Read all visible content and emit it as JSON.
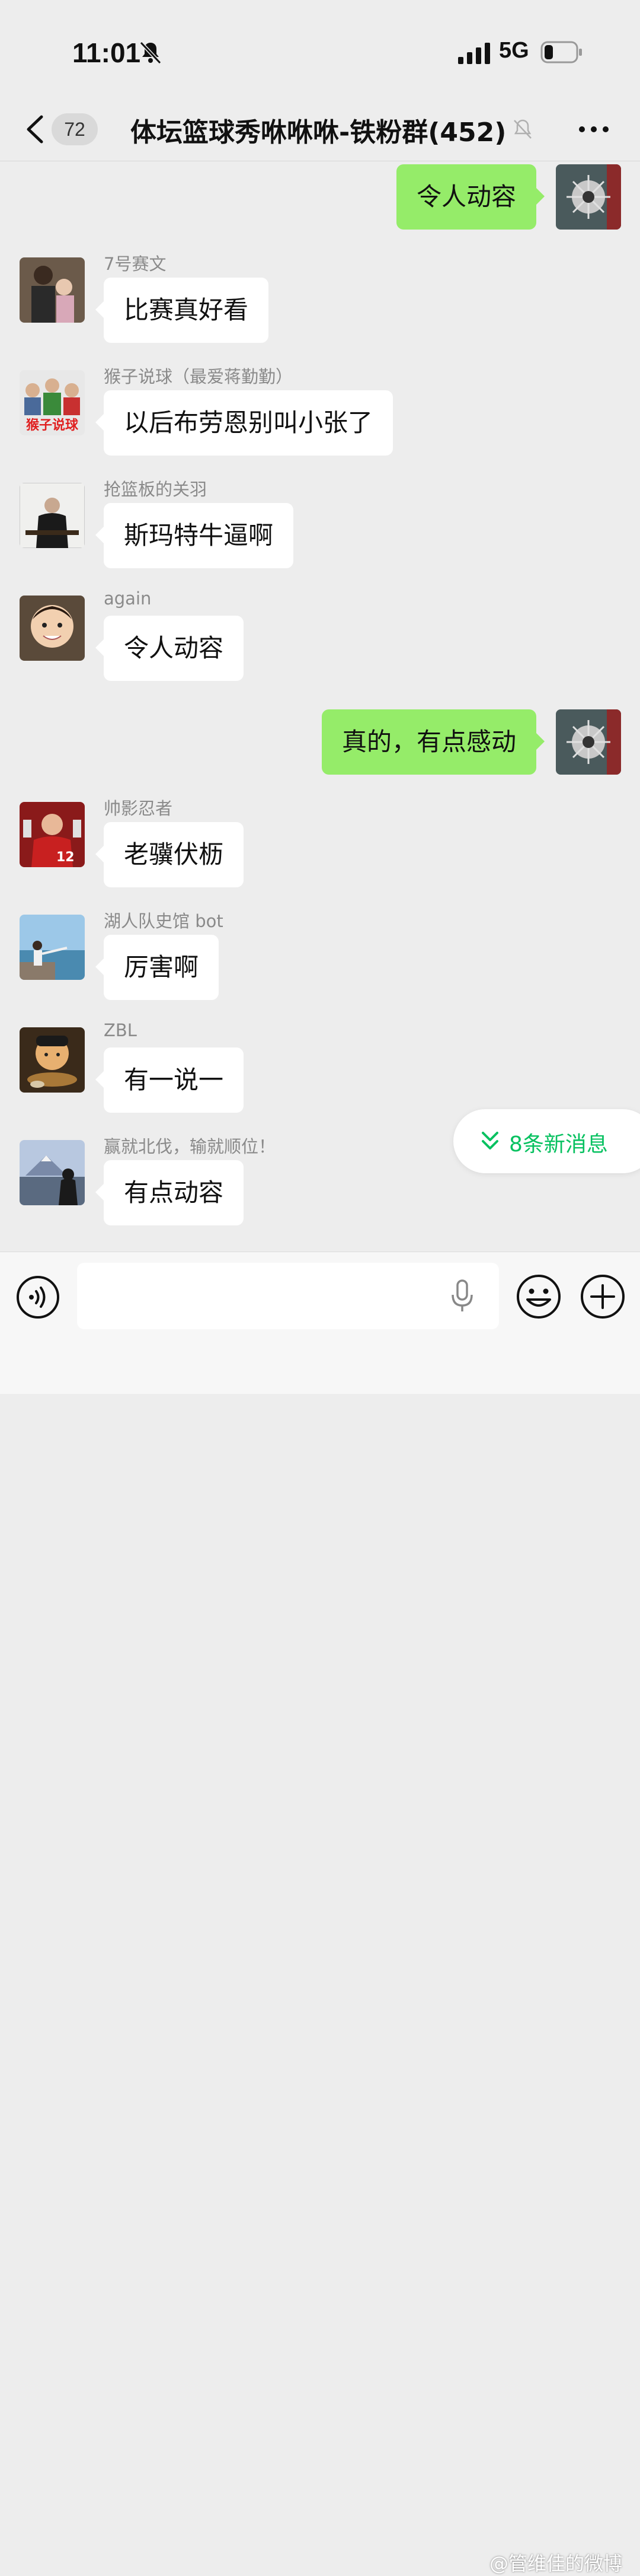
{
  "status_bar": {
    "time": "11:01",
    "network": "5G"
  },
  "nav": {
    "unread_count": "72",
    "title": "体坛篮球秀咻咻咻-铁粉群(452)"
  },
  "messages": [
    {
      "direction": "out",
      "text": "令人动容"
    },
    {
      "direction": "in",
      "sender": "7号赛文",
      "text": "比赛真好看"
    },
    {
      "direction": "in",
      "sender": "猴子说球（最爱蒋勤勤）",
      "text": "以后布劳恩别叫小张了",
      "avatar_caption": "猴子说球"
    },
    {
      "direction": "in",
      "sender": "抢篮板的关羽",
      "text": "斯玛特牛逼啊"
    },
    {
      "direction": "in",
      "sender": "again",
      "text": "令人动容"
    },
    {
      "direction": "out",
      "text": "真的，有点感动"
    },
    {
      "direction": "in",
      "sender": "帅影忍者",
      "text": "老骥伏枥"
    },
    {
      "direction": "in",
      "sender": "湖人队史馆 bot",
      "text": "厉害啊"
    },
    {
      "direction": "in",
      "sender": "ZBL",
      "text": "有一说一"
    },
    {
      "direction": "in",
      "sender": "赢就北伐，输就顺位！",
      "text": "有点动容"
    }
  ],
  "new_messages": {
    "label": "8条新消息"
  },
  "input_bar": {
    "value": "",
    "placeholder": ""
  },
  "watermark": "@管维佳的微博",
  "colors": {
    "background": "#ededed",
    "outgoing_bubble": "#95ec69",
    "incoming_bubble": "#ffffff",
    "accent_green": "#07c160"
  }
}
